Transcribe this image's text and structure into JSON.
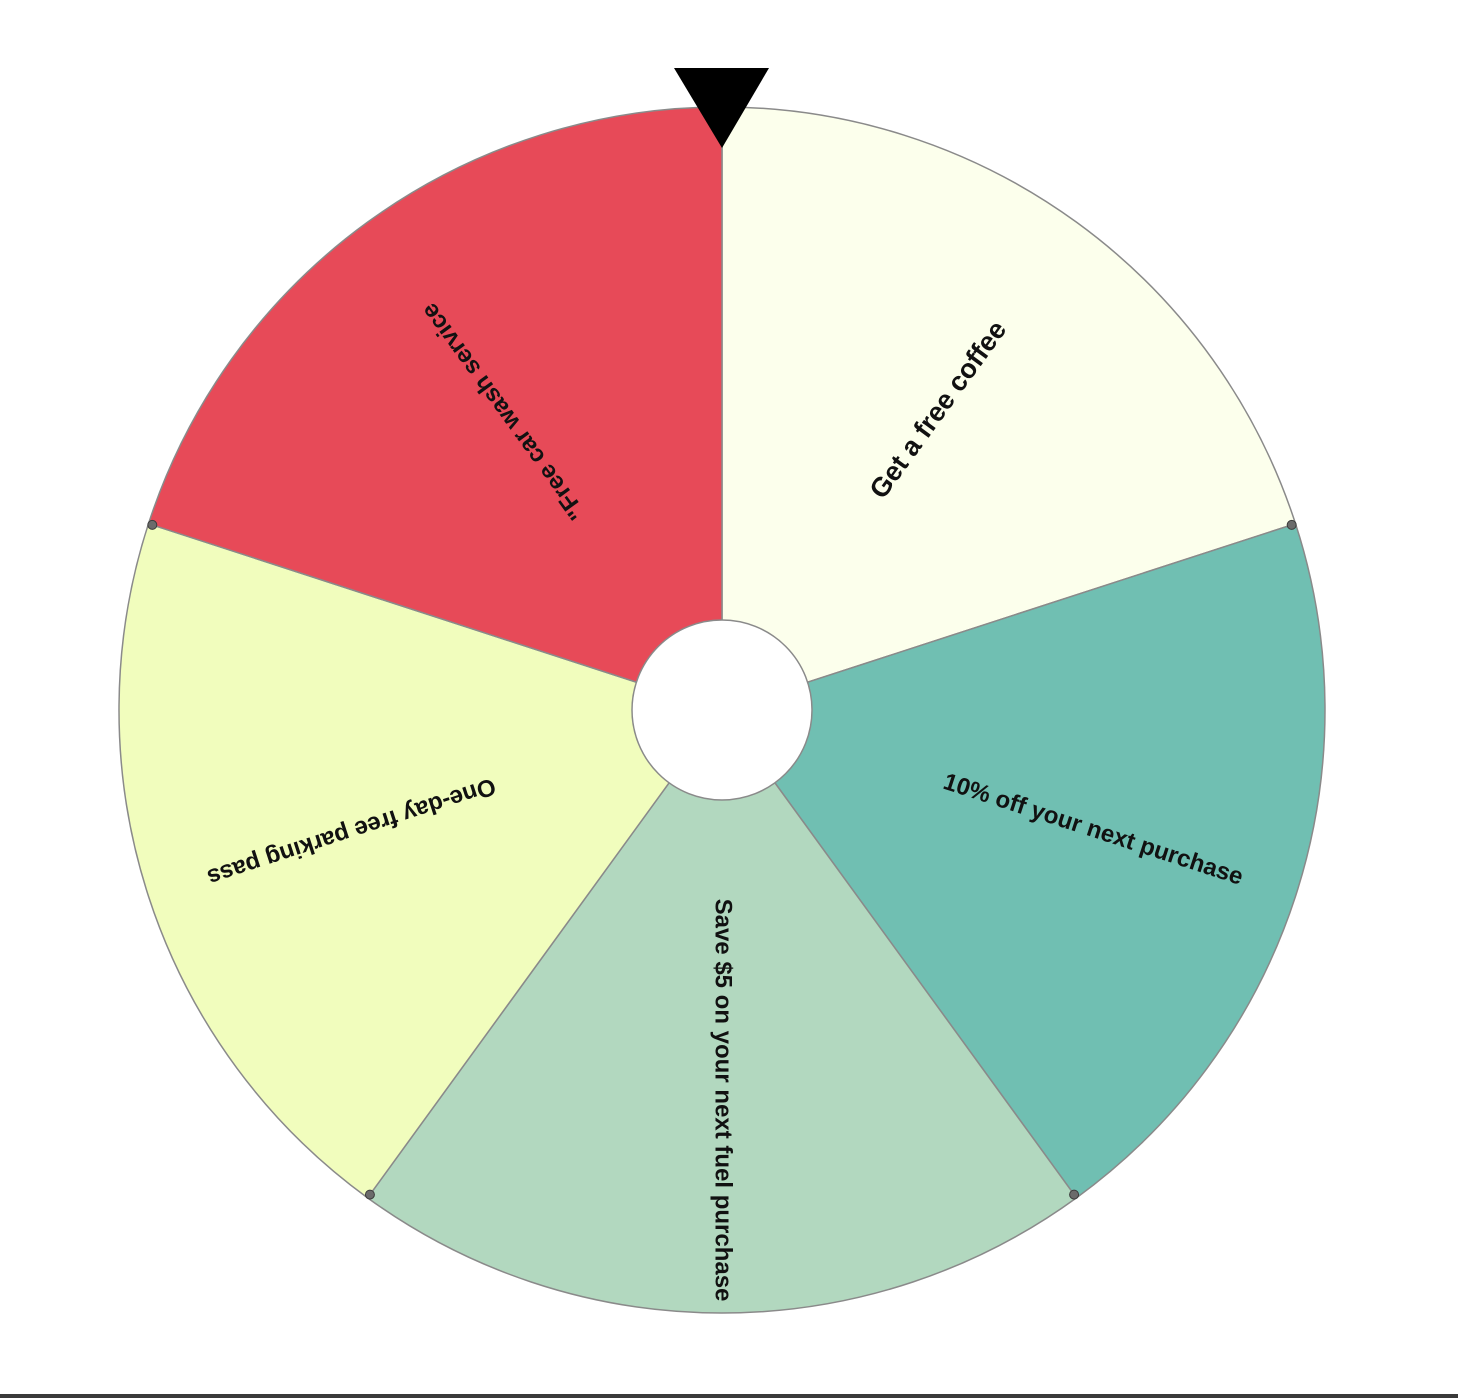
{
  "wheel": {
    "segments": [
      {
        "label": "Get a free coffee",
        "color": "#fcffec"
      },
      {
        "label": "10% off your next purchase",
        "color": "#70bfb2"
      },
      {
        "label": "Save $5 on your next fuel purchase",
        "color": "#b2d8bf"
      },
      {
        "label": "One-day free parking pass",
        "color": "#f1fdbd"
      },
      {
        "label": "\"Free car wash service",
        "color": "#e74a58"
      }
    ],
    "pointer_color": "#000000",
    "hub_color": "#ffffff",
    "border_color": "#8a8a8a"
  }
}
